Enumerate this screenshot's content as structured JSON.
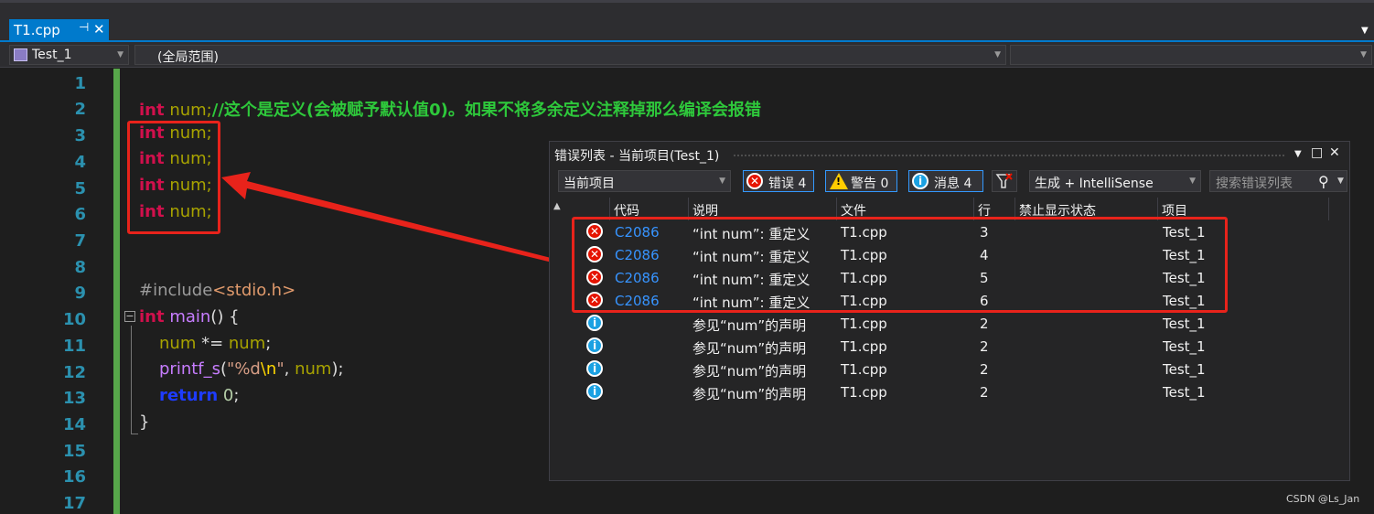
{
  "tab": {
    "filename": "T1.cpp",
    "pin_glyph": "⊣",
    "close_glyph": "✕"
  },
  "navbar": {
    "project": "Test_1",
    "scope": "(全局范围)",
    "member": ""
  },
  "editor": {
    "line_numbers": [
      "1",
      "2",
      "3",
      "4",
      "5",
      "6",
      "7",
      "8",
      "9",
      "10",
      "11",
      "12",
      "13",
      "14",
      "15",
      "16",
      "17"
    ],
    "lines": {
      "l2_kw": "int",
      "l2_var": " num",
      "l2_rest": ";",
      "l2_comment": "//这个是定义(会被赋予默认值0)。如果不将多余定义注释掉那么编译会报错",
      "l3_kw": "int",
      "l3_var": " num",
      "l3_rest": ";",
      "l4_kw": "int",
      "l4_var": " num",
      "l4_rest": ";",
      "l5_kw": "int",
      "l5_var": " num",
      "l5_rest": ";",
      "l6_kw": "int",
      "l6_var": " num",
      "l6_rest": ";",
      "l9_pre": "#include",
      "l9_inc": "<stdio.h>",
      "l10_kw": "int",
      "l10_fn": " main",
      "l10_rest": "() {",
      "l11_var1": "num",
      "l11_op": " *= ",
      "l11_var2": "num",
      "l11_end": ";",
      "l12_fn": "printf_s",
      "l12_open": "(",
      "l12_str1": "\"%d",
      "l12_esc": "\\n",
      "l12_str2": "\"",
      "l12_mid": ", ",
      "l12_var": "num",
      "l12_end": ");",
      "l13_kw": "return",
      "l13_num": " 0",
      "l13_end": ";",
      "l14": "}"
    }
  },
  "error_list": {
    "title": "错误列表 - 当前项目(Test_1)",
    "scope_combo": "当前项目",
    "errors_btn": "错误 4",
    "warnings_btn": "警告 0",
    "messages_btn": "消息 4",
    "build_combo": "生成 + IntelliSense",
    "search_placeholder": "搜索错误列表",
    "columns": [
      "代码",
      "说明",
      "文件",
      "行",
      "禁止显示状态",
      "项目"
    ],
    "rows": [
      {
        "type": "error",
        "code": "C2086",
        "desc": "“int num”: 重定义",
        "file": "T1.cpp",
        "line": "3",
        "project": "Test_1"
      },
      {
        "type": "error",
        "code": "C2086",
        "desc": "“int num”: 重定义",
        "file": "T1.cpp",
        "line": "4",
        "project": "Test_1"
      },
      {
        "type": "error",
        "code": "C2086",
        "desc": "“int num”: 重定义",
        "file": "T1.cpp",
        "line": "5",
        "project": "Test_1"
      },
      {
        "type": "error",
        "code": "C2086",
        "desc": "“int num”: 重定义",
        "file": "T1.cpp",
        "line": "6",
        "project": "Test_1"
      },
      {
        "type": "info",
        "code": "",
        "desc": "参见“num”的声明",
        "file": "T1.cpp",
        "line": "2",
        "project": "Test_1"
      },
      {
        "type": "info",
        "code": "",
        "desc": "参见“num”的声明",
        "file": "T1.cpp",
        "line": "2",
        "project": "Test_1"
      },
      {
        "type": "info",
        "code": "",
        "desc": "参见“num”的声明",
        "file": "T1.cpp",
        "line": "2",
        "project": "Test_1"
      },
      {
        "type": "info",
        "code": "",
        "desc": "参见“num”的声明",
        "file": "T1.cpp",
        "line": "2",
        "project": "Test_1"
      }
    ]
  },
  "watermark": "CSDN @Ls_Jan",
  "colors": {
    "accent": "#007acc",
    "annotation": "#e8231b",
    "keyword": "#d0104c",
    "comment": "#2ec83b",
    "line_number": "#2b91af"
  }
}
